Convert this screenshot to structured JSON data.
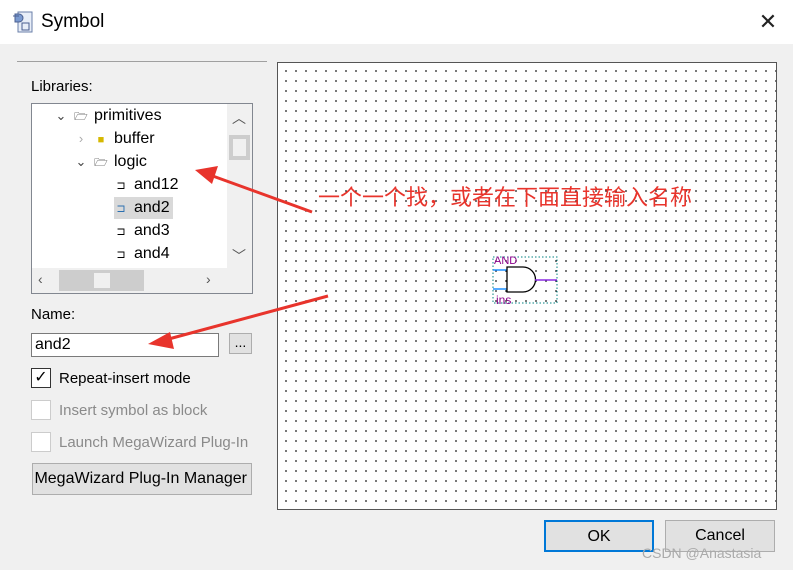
{
  "window": {
    "title": "Symbol",
    "close": "✕"
  },
  "libraries": {
    "label": "Libraries:",
    "items": [
      {
        "label": "primitives",
        "expanded": true
      },
      {
        "label": "buffer",
        "expanded": false
      },
      {
        "label": "logic",
        "expanded": true
      },
      {
        "label": "and12"
      },
      {
        "label": "and2",
        "selected": true
      },
      {
        "label": "and3"
      },
      {
        "label": "and4"
      }
    ]
  },
  "name": {
    "label": "Name:",
    "value": "and2",
    "browse": "..."
  },
  "options": {
    "repeat": {
      "label": "Repeat-insert mode",
      "checked": true
    },
    "block": {
      "label": "Insert symbol as block",
      "checked": false
    },
    "launch": {
      "label": "Launch MegaWizard Plug-In",
      "checked": false
    }
  },
  "megawizard_button": "MegaWizard Plug-In Manager...",
  "symbol": {
    "type_label": "AND",
    "instance_label": "ins"
  },
  "annotation": "一个一个找，或者在下面直接输入名称",
  "buttons": {
    "ok": "OK",
    "cancel": "Cancel"
  },
  "watermark": "CSDN @Anastasia"
}
